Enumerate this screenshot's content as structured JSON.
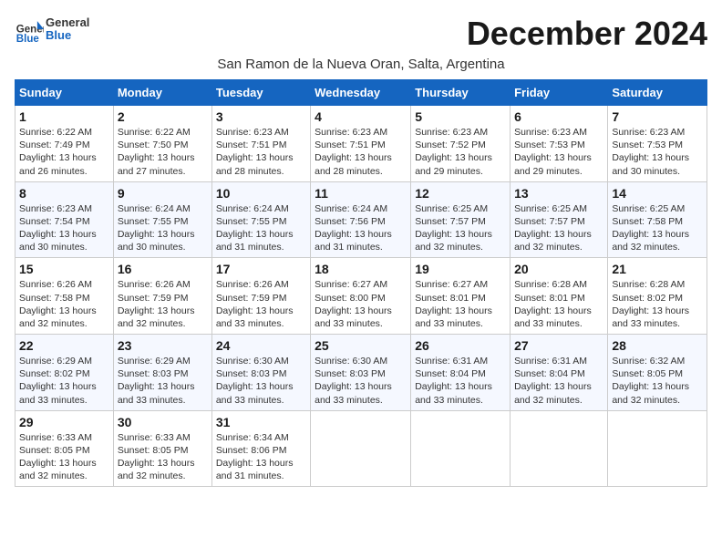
{
  "logo": {
    "general": "General",
    "blue": "Blue"
  },
  "title": "December 2024",
  "subtitle": "San Ramon de la Nueva Oran, Salta, Argentina",
  "weekdays": [
    "Sunday",
    "Monday",
    "Tuesday",
    "Wednesday",
    "Thursday",
    "Friday",
    "Saturday"
  ],
  "weeks": [
    [
      {
        "day": "1",
        "sunrise": "6:22 AM",
        "sunset": "7:49 PM",
        "daylight": "13 hours and 26 minutes."
      },
      {
        "day": "2",
        "sunrise": "6:22 AM",
        "sunset": "7:50 PM",
        "daylight": "13 hours and 27 minutes."
      },
      {
        "day": "3",
        "sunrise": "6:23 AM",
        "sunset": "7:51 PM",
        "daylight": "13 hours and 28 minutes."
      },
      {
        "day": "4",
        "sunrise": "6:23 AM",
        "sunset": "7:51 PM",
        "daylight": "13 hours and 28 minutes."
      },
      {
        "day": "5",
        "sunrise": "6:23 AM",
        "sunset": "7:52 PM",
        "daylight": "13 hours and 29 minutes."
      },
      {
        "day": "6",
        "sunrise": "6:23 AM",
        "sunset": "7:53 PM",
        "daylight": "13 hours and 29 minutes."
      },
      {
        "day": "7",
        "sunrise": "6:23 AM",
        "sunset": "7:53 PM",
        "daylight": "13 hours and 30 minutes."
      }
    ],
    [
      {
        "day": "8",
        "sunrise": "6:23 AM",
        "sunset": "7:54 PM",
        "daylight": "13 hours and 30 minutes."
      },
      {
        "day": "9",
        "sunrise": "6:24 AM",
        "sunset": "7:55 PM",
        "daylight": "13 hours and 30 minutes."
      },
      {
        "day": "10",
        "sunrise": "6:24 AM",
        "sunset": "7:55 PM",
        "daylight": "13 hours and 31 minutes."
      },
      {
        "day": "11",
        "sunrise": "6:24 AM",
        "sunset": "7:56 PM",
        "daylight": "13 hours and 31 minutes."
      },
      {
        "day": "12",
        "sunrise": "6:25 AM",
        "sunset": "7:57 PM",
        "daylight": "13 hours and 32 minutes."
      },
      {
        "day": "13",
        "sunrise": "6:25 AM",
        "sunset": "7:57 PM",
        "daylight": "13 hours and 32 minutes."
      },
      {
        "day": "14",
        "sunrise": "6:25 AM",
        "sunset": "7:58 PM",
        "daylight": "13 hours and 32 minutes."
      }
    ],
    [
      {
        "day": "15",
        "sunrise": "6:26 AM",
        "sunset": "7:58 PM",
        "daylight": "13 hours and 32 minutes."
      },
      {
        "day": "16",
        "sunrise": "6:26 AM",
        "sunset": "7:59 PM",
        "daylight": "13 hours and 32 minutes."
      },
      {
        "day": "17",
        "sunrise": "6:26 AM",
        "sunset": "7:59 PM",
        "daylight": "13 hours and 33 minutes."
      },
      {
        "day": "18",
        "sunrise": "6:27 AM",
        "sunset": "8:00 PM",
        "daylight": "13 hours and 33 minutes."
      },
      {
        "day": "19",
        "sunrise": "6:27 AM",
        "sunset": "8:01 PM",
        "daylight": "13 hours and 33 minutes."
      },
      {
        "day": "20",
        "sunrise": "6:28 AM",
        "sunset": "8:01 PM",
        "daylight": "13 hours and 33 minutes."
      },
      {
        "day": "21",
        "sunrise": "6:28 AM",
        "sunset": "8:02 PM",
        "daylight": "13 hours and 33 minutes."
      }
    ],
    [
      {
        "day": "22",
        "sunrise": "6:29 AM",
        "sunset": "8:02 PM",
        "daylight": "13 hours and 33 minutes."
      },
      {
        "day": "23",
        "sunrise": "6:29 AM",
        "sunset": "8:03 PM",
        "daylight": "13 hours and 33 minutes."
      },
      {
        "day": "24",
        "sunrise": "6:30 AM",
        "sunset": "8:03 PM",
        "daylight": "13 hours and 33 minutes."
      },
      {
        "day": "25",
        "sunrise": "6:30 AM",
        "sunset": "8:03 PM",
        "daylight": "13 hours and 33 minutes."
      },
      {
        "day": "26",
        "sunrise": "6:31 AM",
        "sunset": "8:04 PM",
        "daylight": "13 hours and 33 minutes."
      },
      {
        "day": "27",
        "sunrise": "6:31 AM",
        "sunset": "8:04 PM",
        "daylight": "13 hours and 32 minutes."
      },
      {
        "day": "28",
        "sunrise": "6:32 AM",
        "sunset": "8:05 PM",
        "daylight": "13 hours and 32 minutes."
      }
    ],
    [
      {
        "day": "29",
        "sunrise": "6:33 AM",
        "sunset": "8:05 PM",
        "daylight": "13 hours and 32 minutes."
      },
      {
        "day": "30",
        "sunrise": "6:33 AM",
        "sunset": "8:05 PM",
        "daylight": "13 hours and 32 minutes."
      },
      {
        "day": "31",
        "sunrise": "6:34 AM",
        "sunset": "8:06 PM",
        "daylight": "13 hours and 31 minutes."
      },
      null,
      null,
      null,
      null
    ]
  ],
  "labels": {
    "sunrise": "Sunrise:",
    "sunset": "Sunset:",
    "daylight": "Daylight:"
  }
}
